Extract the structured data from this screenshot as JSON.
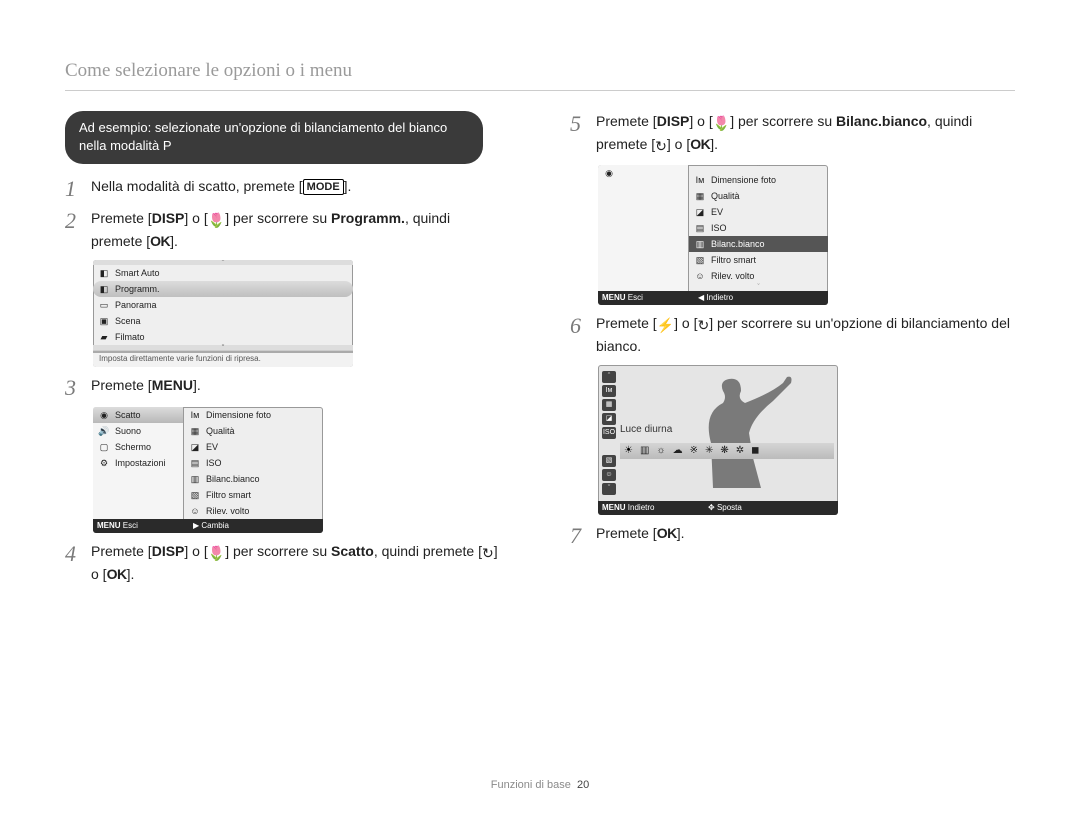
{
  "header": "Come selezionare le opzioni o i menu",
  "example_box": "Ad esempio: selezionate un'opzione di bilanciamento del bianco nella modalità P",
  "buttons": {
    "mode": "MODE",
    "disp": "DISP",
    "menu": "MENU",
    "ok": "OK"
  },
  "steps": {
    "s1": "Nella modalità di scatto, premete [",
    "s1_end": "].",
    "s2a": "Premete [",
    "s2b": "] o [",
    "s2c": "] per scorrere su ",
    "s2d": "Programm.",
    "s2e": ", quindi premete [",
    "s2f": "].",
    "s3": "Premete [",
    "s3_end": "].",
    "s4a": "Premete [",
    "s4b": "] o [",
    "s4c": "] per scorrere su ",
    "s4d": "Scatto",
    "s4e": ", quindi premete [",
    "s4f": "] o [",
    "s4g": "].",
    "s5a": "Premete [",
    "s5b": "] o [",
    "s5c": "] per scorrere su ",
    "s5d": "Bilanc.bianco",
    "s5e": ", quindi premete [",
    "s5f": "] o [",
    "s5g": "].",
    "s6a": "Premete [",
    "s6b": "] o [",
    "s6c": "] per scorrere su un'opzione di bilanciamento del bianco.",
    "s7a": "Premete [",
    "s7b": "]."
  },
  "screen1": {
    "items": [
      "Smart Auto",
      "Programm.",
      "Panorama",
      "Scena",
      "Filmato"
    ],
    "hint": "Imposta direttamente varie funzioni di ripresa."
  },
  "screen2": {
    "left": [
      "Scatto",
      "Suono",
      "Schermo",
      "Impostazioni"
    ],
    "right": [
      "Dimensione foto",
      "Qualità",
      "EV",
      "ISO",
      "Bilanc.bianco",
      "Filtro smart",
      "Rilev. volto"
    ],
    "footer_left": "Esci",
    "footer_left_btn": "MENU",
    "footer_right": "Cambia",
    "footer_right_glyph": "▶"
  },
  "screen3": {
    "right": [
      "Dimensione foto",
      "Qualità",
      "EV",
      "ISO",
      "Bilanc.bianco",
      "Filtro smart",
      "Rilev. volto"
    ],
    "footer_left": "Esci",
    "footer_left_btn": "MENU",
    "footer_right": "Indietro",
    "footer_right_glyph": "◀"
  },
  "screen4": {
    "label": "Luce diurna",
    "footer_left": "Indietro",
    "footer_left_btn": "MENU",
    "footer_right": "Sposta",
    "footer_right_glyph": "✥"
  },
  "footer": {
    "section": "Funzioni di base",
    "page": "20"
  }
}
